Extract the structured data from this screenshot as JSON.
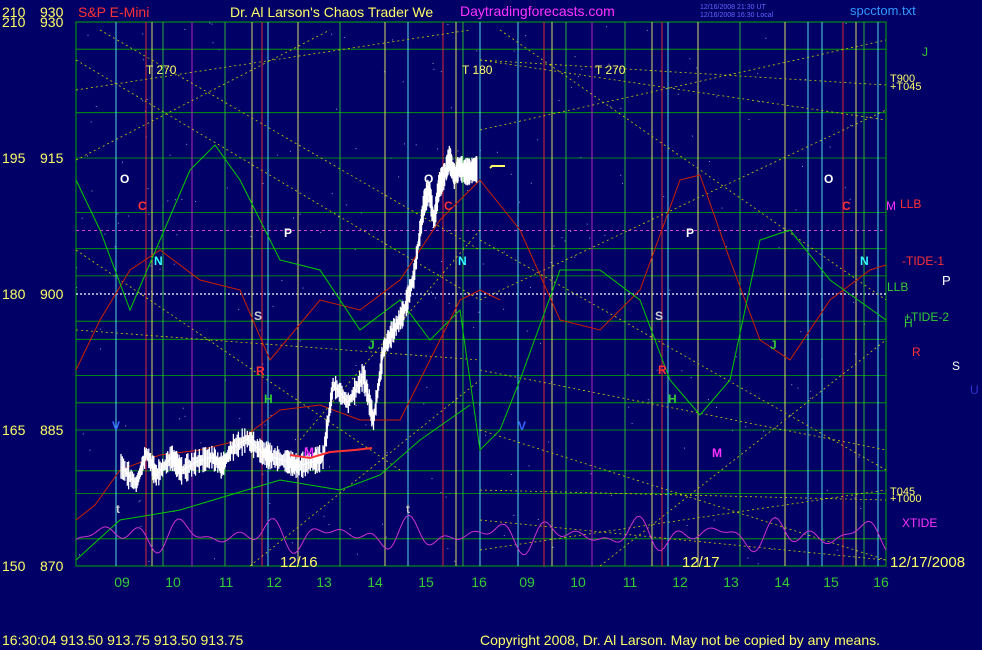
{
  "header": {
    "left_axis_top": "210",
    "right_axis_top": "930",
    "symbol": "S&P E-Mini",
    "title": "Dr. Al Larson's Chaos Trader We",
    "site": "Daytradingforecasts.com",
    "ts_ut": "12/16/2008 21:30 UT",
    "ts_local": "12/16/2008 16:30 Local",
    "filename": "spcctom.txt"
  },
  "footer": {
    "quote": "16:30:04  913.50 913.75 913.50 913.75",
    "copyright": "Copyright 2008, Dr. Al Larson. May not be copied by any means."
  },
  "colors": {
    "background": "#000066",
    "grid_green": "#00aa00",
    "price_white": "#ffffff",
    "red_line": "#cc2200",
    "green_line": "#00cc00",
    "magenta_line": "#cc33cc",
    "yellow_dotted": "#cccc00",
    "vline_cyan": "#66ffff",
    "vline_red": "#ff3333",
    "vline_yellow": "#ffff66",
    "vline_green": "#33cc33",
    "vline_magenta": "#cc33cc"
  },
  "chart_data": {
    "type": "line",
    "title": "S&P E-Mini",
    "x_labels": [
      "09",
      "10",
      "11",
      "12",
      "13",
      "14",
      "15",
      "16",
      "09",
      "10",
      "11",
      "12",
      "13",
      "14",
      "15",
      "16"
    ],
    "date_labels": [
      "12/16",
      "12/17",
      "12/17/2008"
    ],
    "y_left_ticks": [
      "210",
      "195",
      "180",
      "165",
      "150"
    ],
    "y_right_ticks": [
      "930",
      "915",
      "900",
      "885",
      "870"
    ],
    "ylim": [
      870,
      930
    ],
    "price_series": {
      "name": "price",
      "x": [
        0.0,
        0.3,
        0.5,
        0.7,
        1.0,
        1.2,
        1.5,
        1.8,
        2.0,
        2.2,
        2.5,
        2.8,
        3.0,
        3.3,
        3.5,
        3.8,
        4.0,
        4.2,
        4.5,
        4.8,
        5.0,
        5.2,
        5.4,
        5.6,
        5.8,
        6.0,
        6.1,
        6.2,
        6.3,
        6.4,
        6.5,
        6.6,
        6.7,
        6.8,
        6.9,
        7.0,
        7.05
      ],
      "close": [
        881,
        879,
        882.5,
        880,
        882,
        880.5,
        881.5,
        882,
        881,
        883,
        884,
        882.5,
        882,
        881.5,
        881,
        881.5,
        882,
        890,
        888,
        891,
        886,
        894,
        896,
        898,
        902,
        910,
        911.5,
        908,
        912,
        913,
        915,
        913,
        914,
        913.5,
        913.5,
        913.75,
        913.75
      ]
    },
    "right_labels": [
      "T900",
      "+T045",
      "-TIDE-1",
      "LLB",
      "+TIDE-2",
      "T045",
      "+T000",
      "XTIDE",
      "J",
      "P",
      "H",
      "R",
      "S",
      "U",
      "M",
      "LLB"
    ],
    "period_labels": [
      "T 270",
      "T 180",
      "T 270"
    ],
    "markers": [
      "O",
      "C",
      "N",
      "P",
      "S",
      "R",
      "H",
      "J",
      "M",
      "V",
      "t",
      "O",
      "C",
      "N",
      "P",
      "S",
      "R",
      "H",
      "J",
      "M",
      "V",
      "t",
      "O",
      "C",
      "N"
    ]
  }
}
